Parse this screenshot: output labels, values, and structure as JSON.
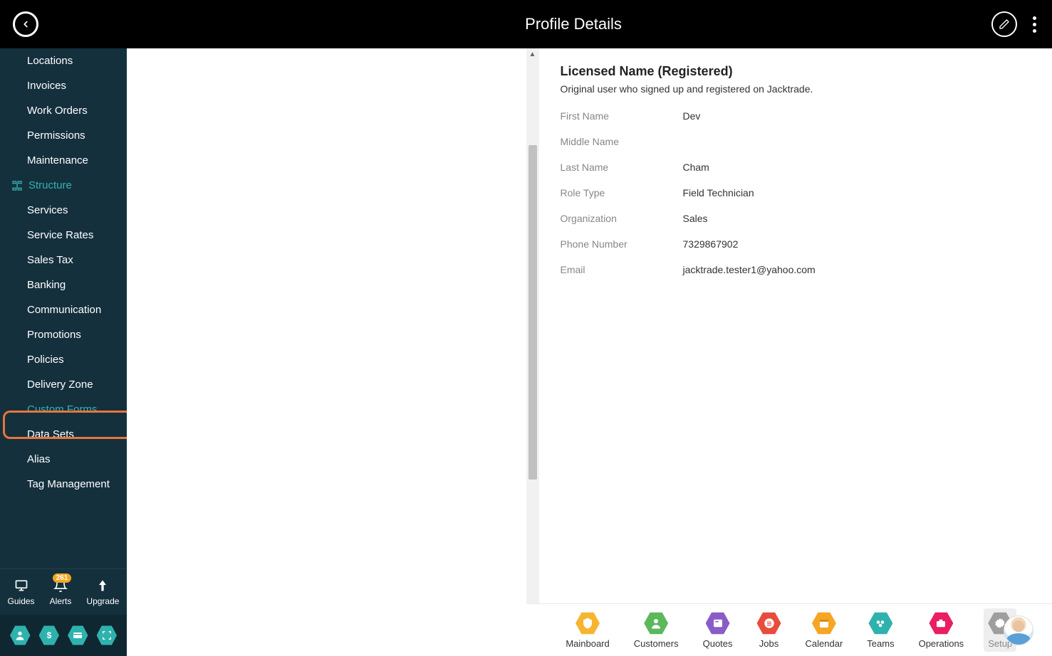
{
  "header": {
    "title": "Profile Details"
  },
  "sidebar": {
    "items": [
      {
        "label": "Locations"
      },
      {
        "label": "Invoices"
      },
      {
        "label": "Work Orders"
      },
      {
        "label": "Permissions"
      },
      {
        "label": "Maintenance"
      }
    ],
    "section_label": "Structure",
    "structure_items": [
      {
        "label": "Services"
      },
      {
        "label": "Service Rates"
      },
      {
        "label": "Sales Tax"
      },
      {
        "label": "Banking"
      },
      {
        "label": "Communication"
      },
      {
        "label": "Promotions"
      },
      {
        "label": "Policies"
      },
      {
        "label": "Delivery Zone"
      },
      {
        "label": "Custom Forms"
      },
      {
        "label": "Data Sets"
      },
      {
        "label": "Alias"
      },
      {
        "label": "Tag Management"
      }
    ],
    "bottom": {
      "guides": "Guides",
      "alerts": "Alerts",
      "alerts_badge": "261",
      "upgrade": "Upgrade"
    }
  },
  "content": {
    "section_title": "Licensed Name (Registered)",
    "section_sub": "Original user who signed up and registered on Jacktrade.",
    "fields": [
      {
        "label": "First Name",
        "value": "Dev"
      },
      {
        "label": "Middle Name",
        "value": ""
      },
      {
        "label": "Last Name",
        "value": "Cham"
      },
      {
        "label": "Role Type",
        "value": "Field Technician"
      },
      {
        "label": "Organization",
        "value": "Sales"
      },
      {
        "label": "Phone Number",
        "value": "7329867902"
      },
      {
        "label": "Email",
        "value": "jacktrade.tester1@yahoo.com"
      }
    ]
  },
  "bottombar": {
    "items": [
      {
        "label": "Mainboard",
        "color": "#f5b52e"
      },
      {
        "label": "Customers",
        "color": "#5cb85c"
      },
      {
        "label": "Quotes",
        "color": "#8a5cc7"
      },
      {
        "label": "Jobs",
        "color": "#e84c3d"
      },
      {
        "label": "Calendar",
        "color": "#f5a623"
      },
      {
        "label": "Teams",
        "color": "#2fb2ae"
      },
      {
        "label": "Operations",
        "color": "#e91e63"
      },
      {
        "label": "Setup",
        "color": "#9e9e9e"
      }
    ]
  }
}
